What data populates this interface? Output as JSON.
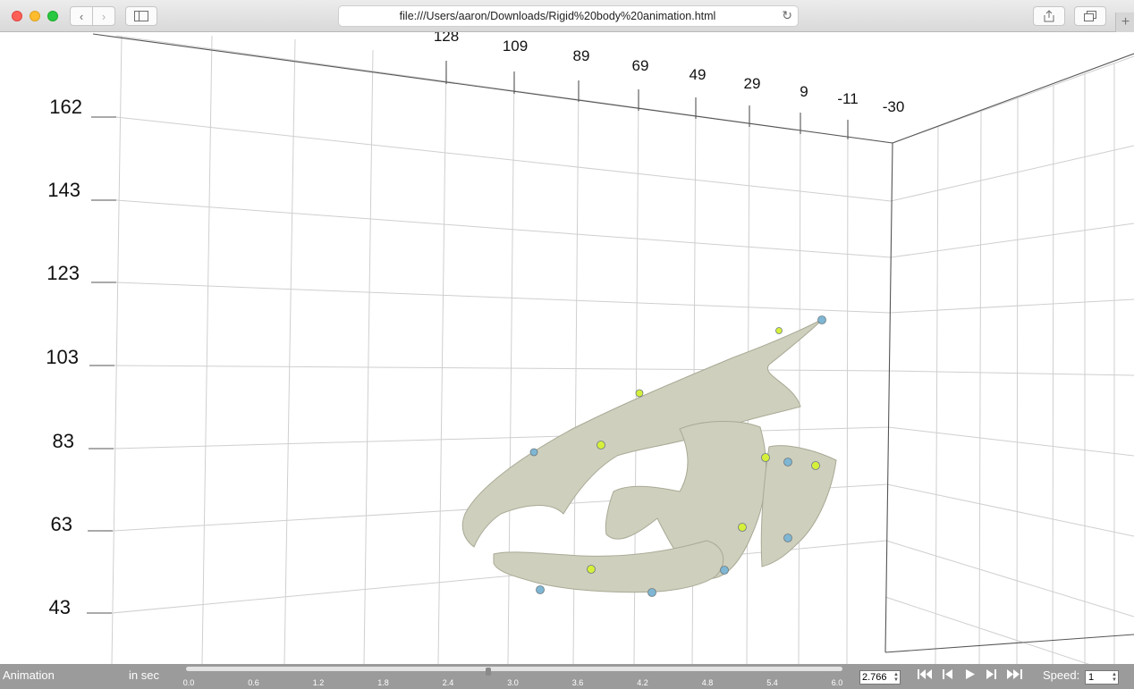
{
  "browser": {
    "url": "file:///Users/aaron/Downloads/Rigid%20body%20animation.html",
    "reload_icon": "reload-icon"
  },
  "plot": {
    "y_ticks": [
      "162",
      "143",
      "123",
      "103",
      "83",
      "63",
      "43"
    ],
    "x_ticks": [
      "128",
      "109",
      "89",
      "69",
      "49",
      "29",
      "9",
      "-11",
      "-30"
    ],
    "mesh_color": "#cfcfbd",
    "marker_colors": [
      "#d6ef3a",
      "#7fb6d3"
    ]
  },
  "animation": {
    "label": "Animation",
    "unit_label": "in sec",
    "ticks": [
      "0.0",
      "0.6",
      "1.2",
      "1.8",
      "2.4",
      "3.0",
      "3.6",
      "4.2",
      "4.8",
      "5.4",
      "6.0"
    ],
    "current_time": "2.766",
    "progress": 0.461,
    "speed_label": "Speed:",
    "speed_value": "1",
    "controls": [
      "skip-to-start-icon",
      "step-back-icon",
      "play-icon",
      "step-forward-icon",
      "skip-to-end-icon"
    ]
  }
}
